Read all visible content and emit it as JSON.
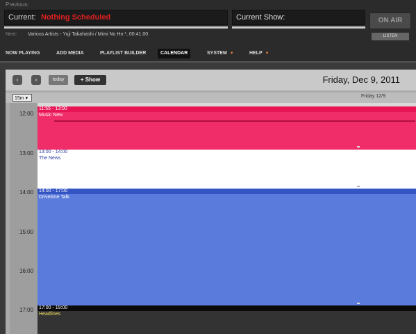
{
  "player": {
    "previous_label": "Previous:",
    "current_label": "Current:",
    "current_value": "Nothing Scheduled",
    "current_show_label": "Current Show:",
    "next_label": "Next:",
    "next_value": "Various Artists - Yuji Takahashi / Mimi No Ho *, 00:41.00",
    "on_air_label": "ON AIR",
    "listen_label": "LISTEN"
  },
  "nav": {
    "items": [
      {
        "label": "NOW PLAYING"
      },
      {
        "label": "ADD MEDIA"
      },
      {
        "label": "PLAYLIST BUILDER"
      },
      {
        "label": "CALENDAR"
      },
      {
        "label": "SYSTEM"
      },
      {
        "label": "HELP"
      }
    ],
    "active": "CALENDAR"
  },
  "calendar": {
    "today_label": "today",
    "show_label": "Show",
    "title": "Friday, Dec 9, 2011",
    "slot_value": "15m",
    "day_header": "Friday 12/9",
    "hours": [
      "12:00",
      "13:00",
      "14:00",
      "15:00",
      "16:00",
      "17:00"
    ],
    "events": [
      {
        "time": "11:55 - 13:00",
        "title": "Music New",
        "color": "#f02d68",
        "head_color": "#e81555"
      },
      {
        "time": "13:00 - 14:00",
        "title": "The News",
        "color": "#ffffff",
        "head_color": "#ffffff"
      },
      {
        "time": "14:00 - 17:00",
        "title": "Drivetime Talk",
        "color": "#5b7bdc",
        "head_color": "#3454c4"
      },
      {
        "time": "17:00 - 19:00",
        "title": "Headlines",
        "color": "#333333",
        "head_color": "#0a0a0a"
      }
    ]
  },
  "icons": {
    "prev": "chevron-left-icon",
    "next": "chevron-right-icon",
    "plus": "plus-icon",
    "caret": "caret-down-icon"
  }
}
